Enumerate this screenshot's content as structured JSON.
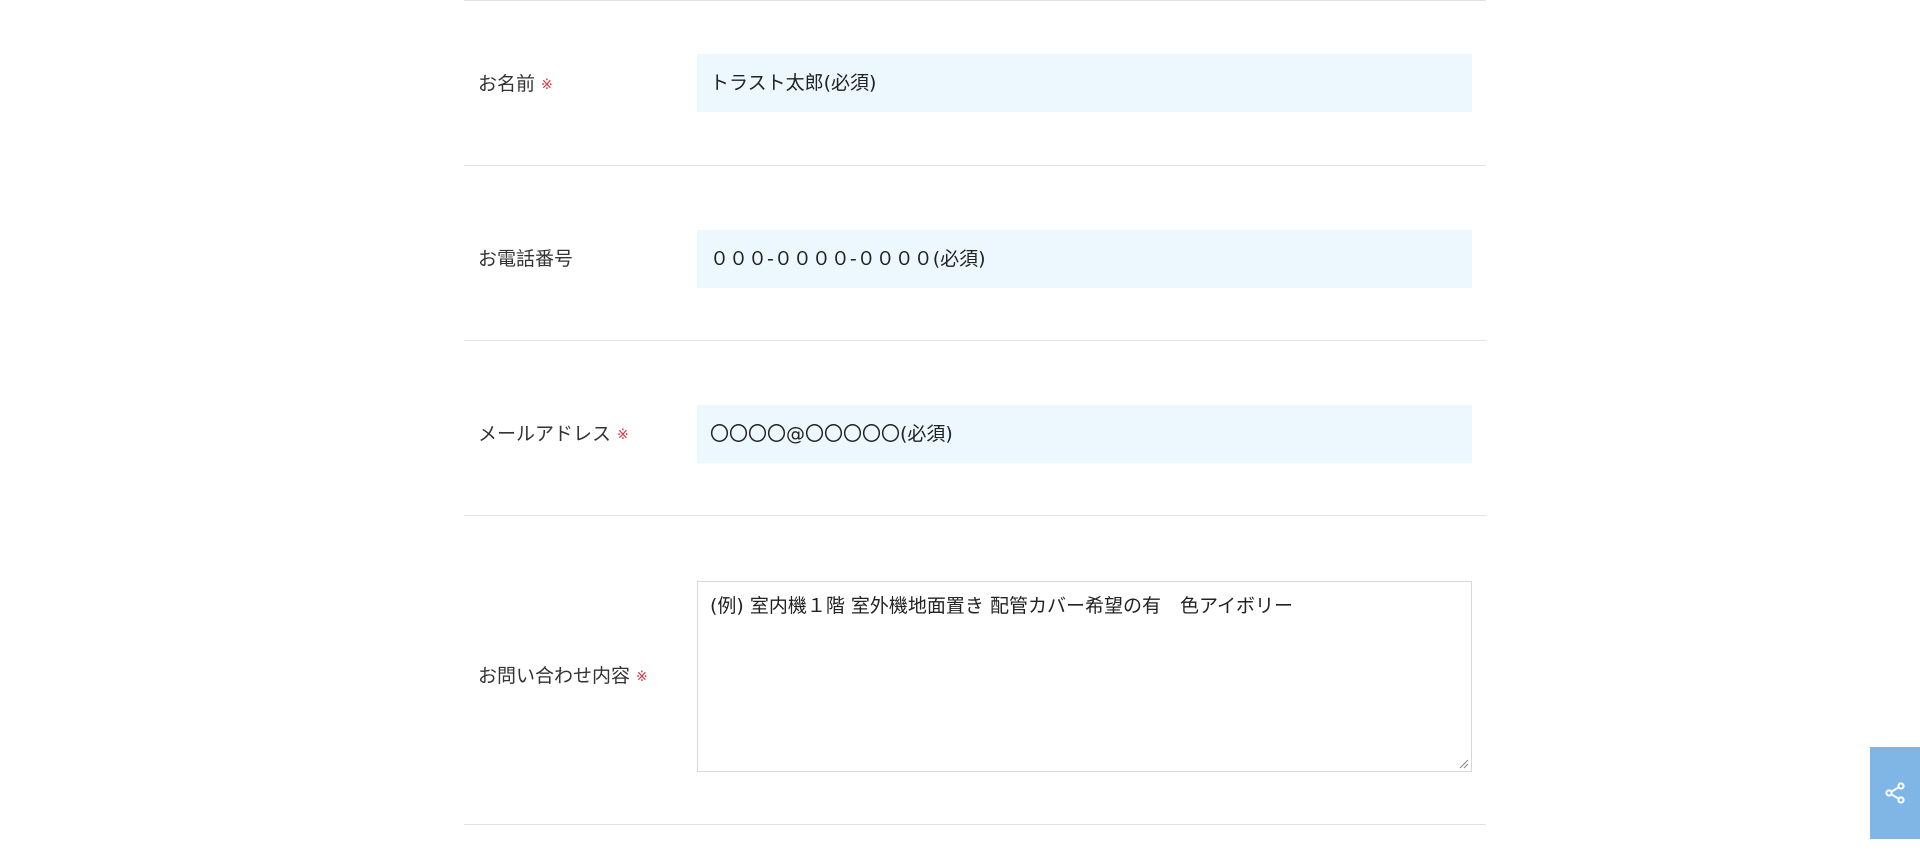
{
  "form": {
    "required_mark": "※",
    "name": {
      "label": "お名前",
      "value": "トラスト太郎(必須)"
    },
    "phone": {
      "label": "お電話番号",
      "value": "０００-００００-００００(必須)"
    },
    "email": {
      "label": "メールアドレス",
      "value": "〇〇〇〇@〇〇〇〇〇(必須)"
    },
    "inquiry": {
      "label": "お問い合わせ内容",
      "value": "(例) 室内機１階 室外機地面置き 配管カバー希望の有　色アイボリー"
    }
  },
  "icons": {
    "share": "share-icon",
    "resize": "resize-grip-icon"
  },
  "colors": {
    "field_background": "#edf7fe",
    "required_mark": "#d9363e",
    "share_button": "#7fb6e6",
    "divider": "#e2e2e2"
  }
}
